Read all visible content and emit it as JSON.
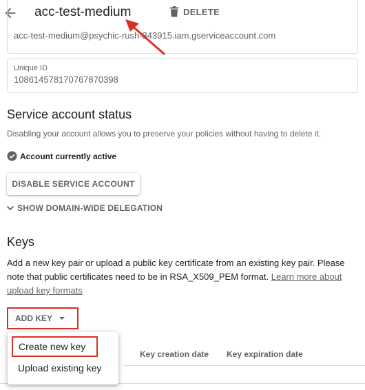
{
  "header": {
    "title": "acc-test-medium",
    "delete_label": "DELETE"
  },
  "details": {
    "email": "acc-test-medium@psychic-rush-343915.iam.gserviceaccount.com",
    "unique_id_label": "Unique ID",
    "unique_id": "108614578170767870398"
  },
  "status": {
    "title": "Service account status",
    "description": "Disabling your account allows you to preserve your policies without having to delete it.",
    "active_text": "Account currently active",
    "disable_label": "DISABLE SERVICE ACCOUNT",
    "delegation_label": "SHOW DOMAIN-WIDE DELEGATION"
  },
  "keys": {
    "title": "Keys",
    "description": "Add a new key pair or upload a public key certificate from an existing key pair. Please note that public certificates need to be in RSA_X509_PEM format.",
    "learn_more": "Learn more about upload key formats",
    "add_key_label": "ADD KEY",
    "columns": [
      "Key creation date",
      "Key expiration date"
    ],
    "menu_items": [
      "Create new key",
      "Upload existing key"
    ]
  },
  "colors": {
    "annotation_red": "#d93025",
    "text_grey": "#5f6368"
  }
}
